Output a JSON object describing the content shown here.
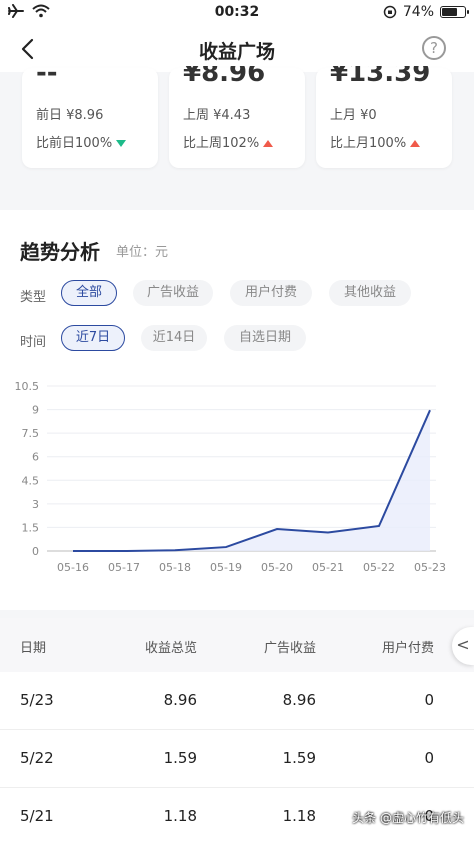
{
  "status_bar": {
    "time": "00:32",
    "battery": "74%",
    "battery_level": 0.74
  },
  "nav": {
    "title": "收益广场",
    "help_symbol": "?",
    "back_symbol": "<"
  },
  "summary": {
    "cards": [
      {
        "value": "--",
        "prev_label": "前日 ¥8.96",
        "compare_label": "比前日100%",
        "trend": "down"
      },
      {
        "value": "¥8.96",
        "prev_label": "上周 ¥4.43",
        "compare_label": "比上周102%",
        "trend": "up"
      },
      {
        "value": "¥13.39",
        "prev_label": "上月 ¥0",
        "compare_label": "比上月100%",
        "trend": "up"
      }
    ]
  },
  "trend": {
    "heading": "趋势分析",
    "unit": "单位：元",
    "type_label": "类型",
    "type_options": [
      "全部",
      "广告收益",
      "用户付费",
      "其他收益"
    ],
    "type_selected": "全部",
    "time_label": "时间",
    "time_options": [
      "近7日",
      "近14日",
      "自选日期"
    ],
    "time_selected": "近7日"
  },
  "chart_data": {
    "type": "area",
    "categories": [
      "05-16",
      "05-17",
      "05-18",
      "05-19",
      "05-20",
      "05-21",
      "05-22",
      "05-23"
    ],
    "values": [
      0,
      0,
      0.05,
      0.25,
      1.4,
      1.18,
      1.59,
      8.96
    ],
    "yticks": [
      "0",
      "1.5",
      "3",
      "4.5",
      "6",
      "7.5",
      "9",
      "10.5"
    ],
    "ylim": [
      0,
      10.5
    ],
    "grid": true,
    "line_color": "#2c4aa0",
    "fill_color": "#e8ecfb"
  },
  "table": {
    "headers": [
      "日期",
      "收益总览",
      "广告收益",
      "用户付费"
    ],
    "rows": [
      [
        "5/23",
        "8.96",
        "8.96",
        "0"
      ],
      [
        "5/22",
        "1.59",
        "1.59",
        "0"
      ],
      [
        "5/21",
        "1.18",
        "1.18",
        "0"
      ]
    ],
    "side_tab_symbol": "<"
  },
  "watermark": "头条 @虚心竹有低头"
}
